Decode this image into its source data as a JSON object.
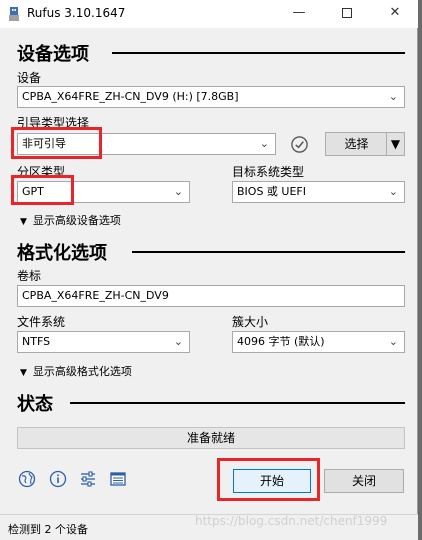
{
  "window": {
    "title": "Rufus 3.10.1647",
    "min_glyph": "—",
    "close_glyph": "✕"
  },
  "device_section": {
    "title": "设备选项",
    "device_label": "设备",
    "device_value": "CPBA_X64FRE_ZH-CN_DV9 (H:) [7.8GB]",
    "boot_label": "引导类型选择",
    "boot_value": "非可引导",
    "select_button": "选择",
    "partition_label": "分区类型",
    "partition_value": "GPT",
    "target_label": "目标系统类型",
    "target_value": "BIOS 或 UEFI",
    "advanced_label": "显示高级设备选项"
  },
  "format_section": {
    "title": "格式化选项",
    "volume_label": "卷标",
    "volume_value": "CPBA_X64FRE_ZH-CN_DV9",
    "fs_label": "文件系统",
    "fs_value": "NTFS",
    "cluster_label": "簇大小",
    "cluster_value": "4096 字节 (默认)",
    "advanced_label": "显示高级格式化选项"
  },
  "status_section": {
    "title": "状态",
    "status_text": "准备就绪"
  },
  "actions": {
    "start_label": "开始",
    "close_label": "关闭"
  },
  "footer": {
    "text": "检测到 2 个设备",
    "watermark": "https://blog.csdn.net/chenf1999"
  },
  "icons": [
    "globe-icon",
    "info-icon",
    "settings-icon",
    "log-icon"
  ],
  "colors": {
    "highlight": "#e8262a",
    "focus": "#0078d7"
  }
}
